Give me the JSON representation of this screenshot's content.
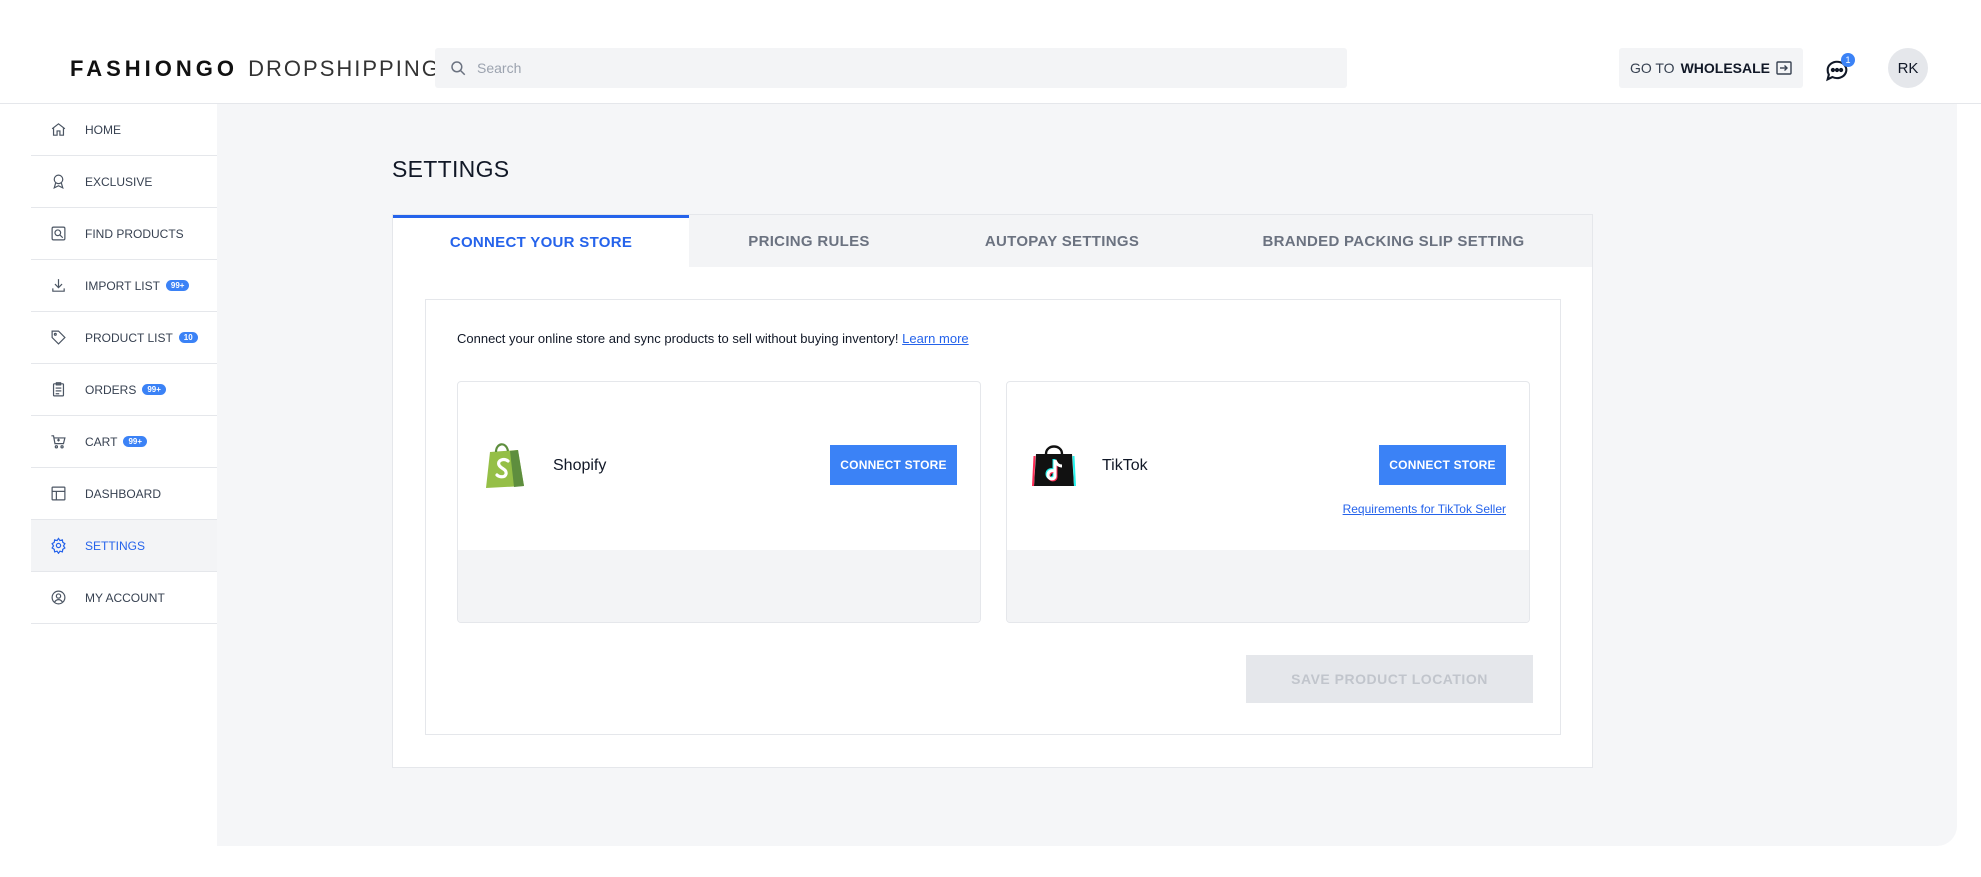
{
  "header": {
    "logo_brand": "FASHIONGO",
    "logo_sub": "DROPSHIPPING",
    "search_placeholder": "Search",
    "goto_prefix": "GO TO",
    "goto_target": "WHOLESALE",
    "chat_badge": "1",
    "avatar_initials": "RK"
  },
  "sidebar": {
    "items": [
      {
        "label": "HOME",
        "icon": "home-icon",
        "badge": ""
      },
      {
        "label": "EXCLUSIVE",
        "icon": "award-icon",
        "badge": ""
      },
      {
        "label": "FIND PRODUCTS",
        "icon": "search-document-icon",
        "badge": ""
      },
      {
        "label": "IMPORT LIST",
        "icon": "download-icon",
        "badge": "99+"
      },
      {
        "label": "PRODUCT LIST",
        "icon": "tag-icon",
        "badge": "10"
      },
      {
        "label": "ORDERS",
        "icon": "clipboard-icon",
        "badge": "99+"
      },
      {
        "label": "CART",
        "icon": "cart-icon",
        "badge": "99+"
      },
      {
        "label": "DASHBOARD",
        "icon": "dashboard-icon",
        "badge": ""
      },
      {
        "label": "SETTINGS",
        "icon": "gear-icon",
        "badge": ""
      },
      {
        "label": "MY ACCOUNT",
        "icon": "user-circle-icon",
        "badge": ""
      }
    ],
    "active": "SETTINGS"
  },
  "main": {
    "title": "SETTINGS",
    "tabs": [
      {
        "label": "CONNECT YOUR STORE"
      },
      {
        "label": "PRICING RULES"
      },
      {
        "label": "AUTOPAY SETTINGS"
      },
      {
        "label": "BRANDED PACKING SLIP SETTING"
      }
    ],
    "intro_text": "Connect your online store and sync products to sell without buying inventory!",
    "intro_link": "Learn more",
    "stores": [
      {
        "name": "Shopify",
        "button": "CONNECT STORE",
        "link": ""
      },
      {
        "name": "TikTok",
        "button": "CONNECT STORE",
        "link": "Requirements for TikTok Seller"
      }
    ],
    "save_button": "SAVE PRODUCT LOCATION"
  },
  "colors": {
    "accent": "#3b82f6",
    "active_text": "#2563eb",
    "shopify_green": "#95bf47",
    "tiktok_cyan": "#25f4ee",
    "tiktok_red": "#fe2c55"
  }
}
